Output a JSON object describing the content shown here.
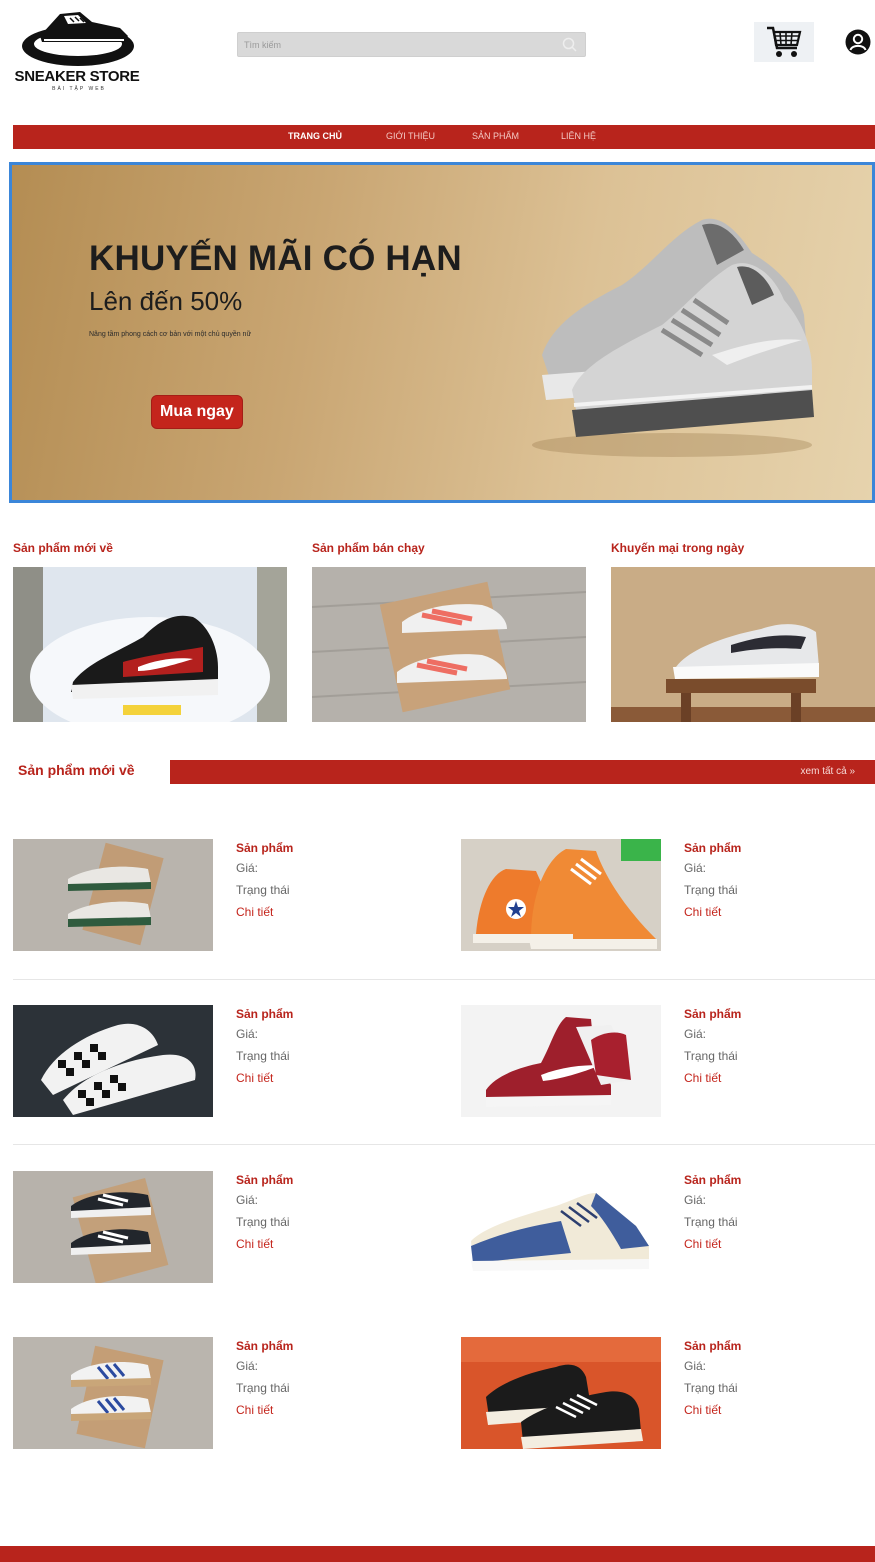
{
  "header": {
    "logo_text": "SNEAKER STORE",
    "logo_sub": "BÀI TẬP WEB",
    "search_placeholder": "Tìm kiếm",
    "icons": {
      "search": "search-icon",
      "cart": "cart-icon",
      "user": "user-icon"
    }
  },
  "nav": {
    "items": [
      {
        "label": "TRANG CHỦ",
        "active": true
      },
      {
        "label": "GIỚI THIỆU",
        "active": false
      },
      {
        "label": "SẢN PHẨM",
        "active": false
      },
      {
        "label": "LIÊN HỆ",
        "active": false
      }
    ]
  },
  "banner": {
    "title": "KHUYẾN MÃI CÓ HẠN",
    "subtitle": "Lên đến 50%",
    "description": "Nâng tầm phong cách cơ bản với một chủ quyền nữ",
    "button_label": "Mua ngay"
  },
  "categories": [
    {
      "title": "Sản phẩm mới về"
    },
    {
      "title": "Sản phẩm bán chạy"
    },
    {
      "title": "Khuyến mại trong ngày"
    }
  ],
  "section": {
    "title": "Sản phẩm mới về",
    "view_all": "xem tất cả »"
  },
  "products": [
    {
      "name": "Sản phẩm",
      "price_label": "Giá:",
      "status_label": "Trạng thái",
      "detail_label": "Chi tiết"
    },
    {
      "name": "Sản phẩm",
      "price_label": "Giá:",
      "status_label": "Trạng thái",
      "detail_label": "Chi tiết"
    },
    {
      "name": "Sản phẩm",
      "price_label": "Giá:",
      "status_label": "Trạng thái",
      "detail_label": "Chi tiết"
    },
    {
      "name": "Sản phẩm",
      "price_label": "Giá:",
      "status_label": "Trạng thái",
      "detail_label": "Chi tiết"
    },
    {
      "name": "Sản phẩm",
      "price_label": "Giá:",
      "status_label": "Trạng thái",
      "detail_label": "Chi tiết"
    },
    {
      "name": "Sản phẩm",
      "price_label": "Giá:",
      "status_label": "Trạng thái",
      "detail_label": "Chi tiết"
    },
    {
      "name": "Sản phẩm",
      "price_label": "Giá:",
      "status_label": "Trạng thái",
      "detail_label": "Chi tiết"
    },
    {
      "name": "Sản phẩm",
      "price_label": "Giá:",
      "status_label": "Trạng thái",
      "detail_label": "Chi tiết"
    }
  ],
  "colors": {
    "brand_red": "#b8241c",
    "banner_gold": "#c9a673",
    "banner_border": "#3b86d9"
  }
}
